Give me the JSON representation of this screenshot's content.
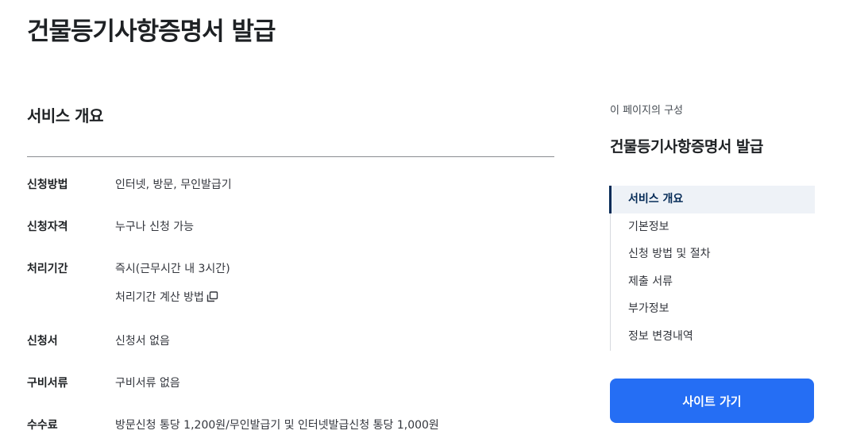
{
  "page": {
    "title": "건물등기사항증명서 발급"
  },
  "overview": {
    "title": "서비스 개요",
    "rows": [
      {
        "label": "신청방법",
        "value": "인터넷, 방문, 무인발급기"
      },
      {
        "label": "신청자격",
        "value": "누구나 신청 가능"
      },
      {
        "label": "처리기간",
        "value": "즉시(근무시간 내 3시간)",
        "link": "처리기간 계산 방법",
        "link_icon": "copy-icon"
      },
      {
        "label": "신청서",
        "value": "신청서 없음"
      },
      {
        "label": "구비서류",
        "value": "구비서류 없음"
      },
      {
        "label": "수수료",
        "value": "방문신청 통당 1,200원/무인발급기 및 인터넷발급신청 통당 1,000원"
      }
    ]
  },
  "toc": {
    "caption": "이 페이지의 구성",
    "title": "건물등기사항증명서 발급",
    "items": [
      {
        "label": "서비스 개요",
        "active": true
      },
      {
        "label": "기본정보",
        "active": false
      },
      {
        "label": "신청 방법 및 절차",
        "active": false
      },
      {
        "label": "제출 서류",
        "active": false
      },
      {
        "label": "부가정보",
        "active": false
      },
      {
        "label": "정보 변경내역",
        "active": false
      }
    ]
  },
  "site_button": {
    "label": "사이트 가기"
  },
  "colors": {
    "primary": "#256ef4",
    "toc_active_text": "#052b57",
    "toc_active_bg": "#eef2f7",
    "divider": "#8a8d91"
  }
}
